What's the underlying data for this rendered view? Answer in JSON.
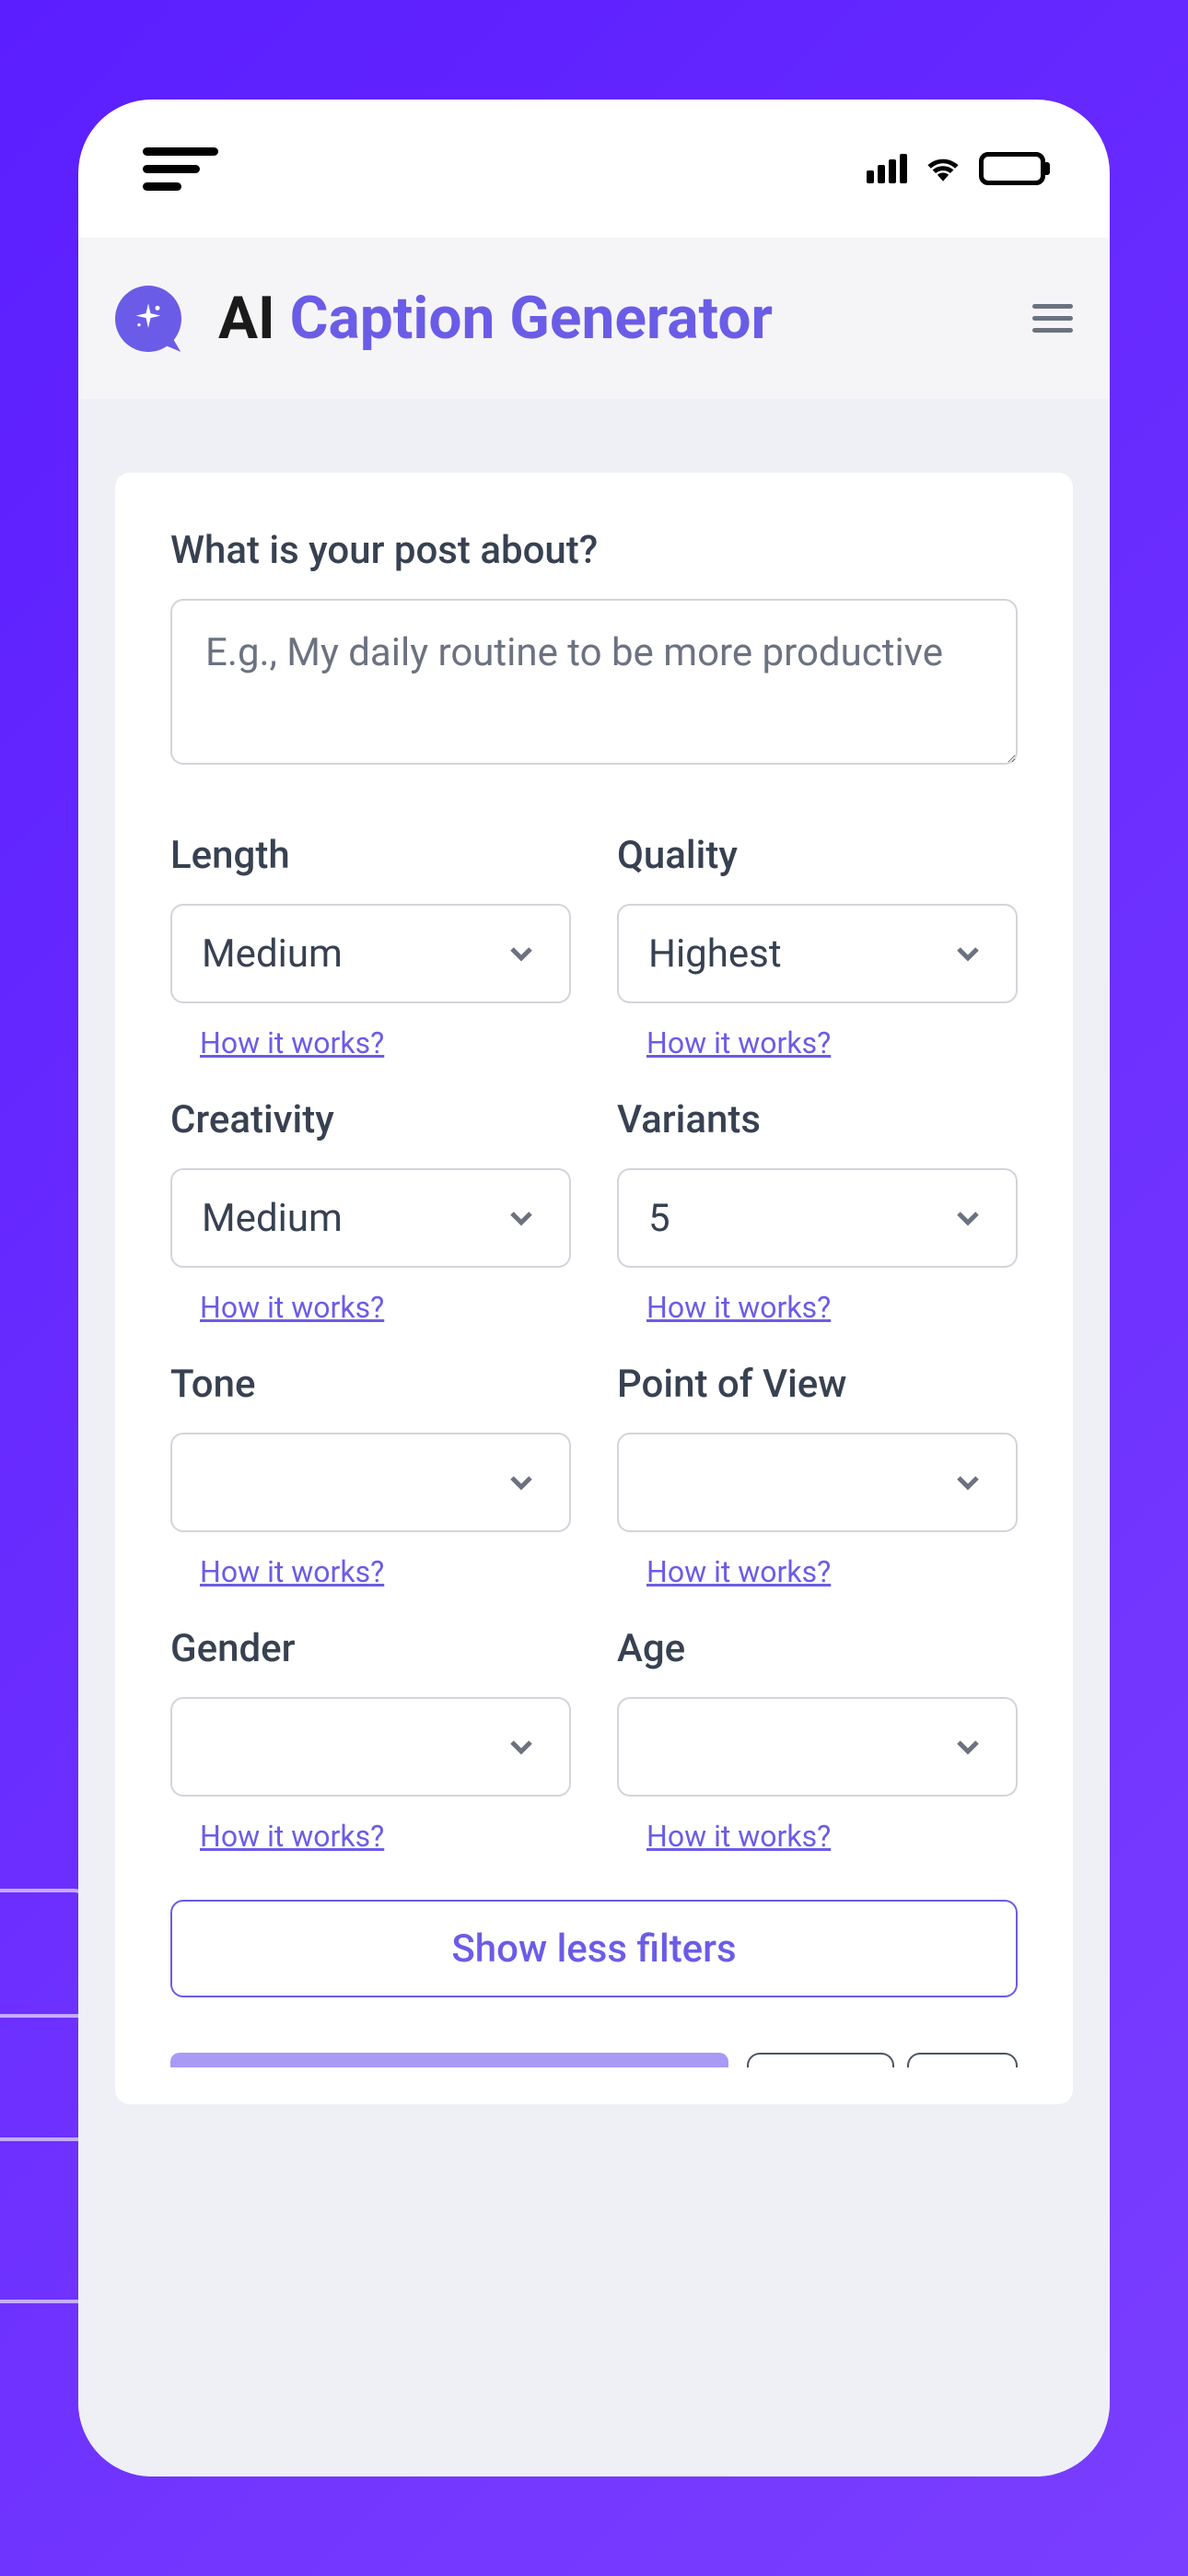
{
  "header": {
    "title_prefix": "AI",
    "title_suffix": "Caption Generator"
  },
  "form": {
    "prompt_label": "What is your post about?",
    "prompt_placeholder": "E.g., My daily routine to be more productive",
    "help_link": "How it works?"
  },
  "filters": {
    "length": {
      "label": "Length",
      "value": "Medium"
    },
    "quality": {
      "label": "Quality",
      "value": "Highest"
    },
    "creativity": {
      "label": "Creativity",
      "value": "Medium"
    },
    "variants": {
      "label": "Variants",
      "value": "5"
    },
    "tone": {
      "label": "Tone",
      "value": ""
    },
    "pov": {
      "label": "Point of View",
      "value": ""
    },
    "gender": {
      "label": "Gender",
      "value": ""
    },
    "age": {
      "label": "Age",
      "value": ""
    }
  },
  "toggle_label": "Show less filters"
}
